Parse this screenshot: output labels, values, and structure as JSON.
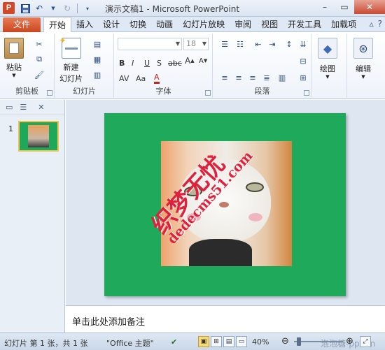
{
  "titlebar": {
    "title": "演示文稿1 - Microsoft PowerPoint",
    "app_icon": "P",
    "qat": [
      "save-icon",
      "undo-icon",
      "redo-icon",
      "customize-icon"
    ]
  },
  "tabs": {
    "file": "文件",
    "items": [
      "开始",
      "插入",
      "设计",
      "切换",
      "动画",
      "幻灯片放映",
      "审阅",
      "视图",
      "开发工具",
      "加载项"
    ],
    "active": "开始"
  },
  "ribbon": {
    "clipboard": {
      "paste": "粘贴",
      "label": "剪贴板"
    },
    "slides": {
      "new_slide_line1": "新建",
      "new_slide_line2": "幻灯片",
      "label": "幻灯片"
    },
    "font": {
      "font_name": "",
      "font_size": "18",
      "label": "字体",
      "bold": "B",
      "italic": "I",
      "underline": "U",
      "shadow": "S",
      "strike": "abc",
      "spacing": "AV",
      "case": "Aa",
      "color": "A",
      "grow": "A",
      "shrink": "A"
    },
    "paragraph": {
      "label": "段落"
    },
    "drawing": {
      "label": "绘图"
    },
    "editing": {
      "label": "编辑"
    }
  },
  "panel": {
    "slide_number": "1"
  },
  "slide": {
    "watermark_line1": "织梦无忧",
    "watermark_line2": "dedecms51.com"
  },
  "notes": {
    "placeholder": "单击此处添加备注"
  },
  "statusbar": {
    "slide_info": "幻灯片 第 1 张，共 1 张",
    "theme": "\"Office 主题\"",
    "zoom": "40%",
    "corner_watermark": "泡泡糖-ppt.cn"
  }
}
